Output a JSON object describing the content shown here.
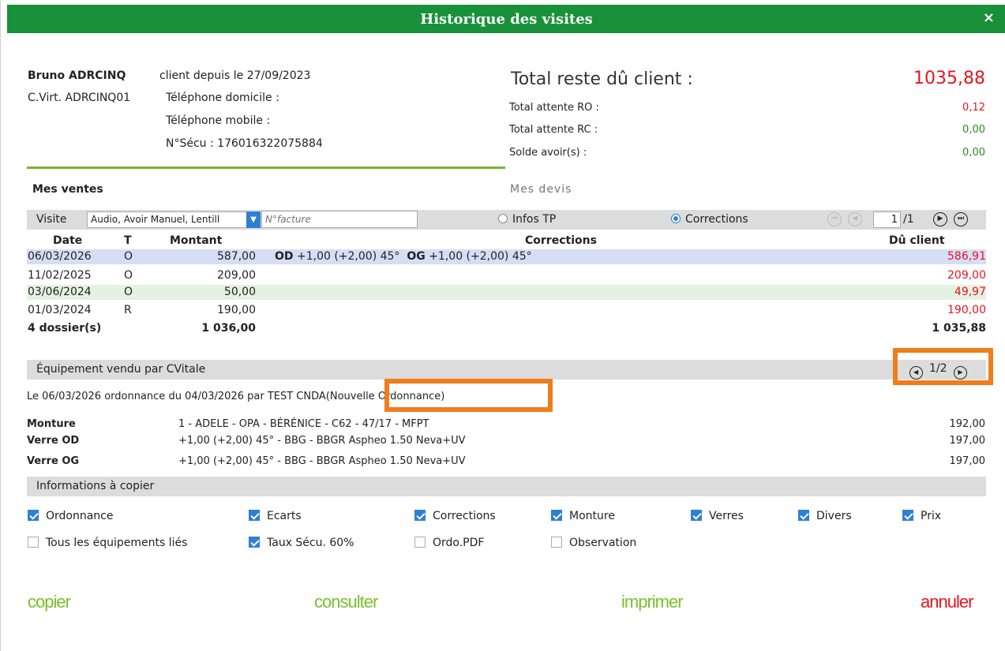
{
  "window": {
    "title": "Historique des visites",
    "close_icon": "×"
  },
  "client": {
    "name": "Bruno ADRCINQ",
    "since": "client depuis le 27/09/2023",
    "card": "C.Virt. ADRCINQ01",
    "phone_home": "Téléphone domicile :",
    "phone_mobile": "Téléphone mobile :",
    "secu": "N°Sécu : 176016322075884"
  },
  "totals": {
    "label": "Total reste dû client :",
    "value": "1035,88",
    "ro_label": "Total attente RO :",
    "ro_value": "0,12",
    "rc_label": "Total attente RC :",
    "rc_value": "0,00",
    "avoir_label": "Solde avoir(s) :",
    "avoir_value": "0,00"
  },
  "tabs": {
    "sales": "Mes ventes",
    "quotes": "Mes devis"
  },
  "filter": {
    "visit_label": "Visite",
    "visit_value": "Audio, Avoir Manuel, Lentill",
    "invoice_placeholder": "N°facture",
    "radio_tp": "Infos TP",
    "radio_corrections": "Corrections",
    "page_current": "1",
    "page_total": "/1"
  },
  "table": {
    "headers": {
      "date": "Date",
      "t": "T",
      "amount": "Montant",
      "corrections": "Corrections",
      "due": "Dû client"
    },
    "rows": [
      {
        "date": "06/03/2026",
        "t": "O",
        "amount": "587,00",
        "od": "OD",
        "od_val": "+1,00 (+2,00) 45°",
        "og": "OG",
        "og_val": "+1,00 (+2,00) 45°",
        "due": "586,91"
      },
      {
        "date": "11/02/2025",
        "t": "O",
        "amount": "209,00",
        "due": "209,00"
      },
      {
        "date": "03/06/2024",
        "t": "O",
        "amount": "50,00",
        "due": "49,97"
      },
      {
        "date": "01/03/2024",
        "t": "R",
        "amount": "190,00",
        "due": "190,00"
      }
    ],
    "footer": {
      "count": "4 dossier(s)",
      "amount": "1 036,00",
      "due": "1 035,88"
    }
  },
  "equipment": {
    "label": "Équipement vendu par CVitale",
    "page": "1/2",
    "line": "Le 06/03/2026  ordonnance du 04/03/2026 par TEST CNDA",
    "line_tag": "(Nouvelle Ordonnance)",
    "items": [
      {
        "label": "Monture",
        "desc": "1 - ADELE - OPA - BÉRÉNICE - C62 - 47/17 - MFPT",
        "price": "192,00"
      },
      {
        "label": "Verre OD",
        "desc": "+1,00 (+2,00) 45° - BBG - BBGR Aspheo 1.50 Neva+UV",
        "price": "197,00"
      },
      {
        "label": "Verre OG",
        "desc": "+1,00 (+2,00) 45° - BBG - BBGR Aspheo 1.50 Neva+UV",
        "price": "197,00"
      }
    ]
  },
  "copy": {
    "label": "Informations à copier",
    "options": {
      "ordonnance": "Ordonnance",
      "ecarts": "Ecarts",
      "corrections": "Corrections",
      "monture": "Monture",
      "verres": "Verres",
      "divers": "Divers",
      "prix": "Prix",
      "tous": "Tous les équipements liés",
      "taux": "Taux Sécu. 60%",
      "ordo_pdf": "Ordo.PDF",
      "observation": "Observation"
    }
  },
  "actions": {
    "copy": "copier",
    "view": "consulter",
    "print": "imprimer",
    "cancel": "annuler"
  },
  "colors": {
    "header_green": "#18913a",
    "accent_green": "#7bbf2a",
    "due_red": "#e8141e",
    "highlight_orange": "#f07d1c",
    "checkbox_blue": "#2e7fd4"
  }
}
